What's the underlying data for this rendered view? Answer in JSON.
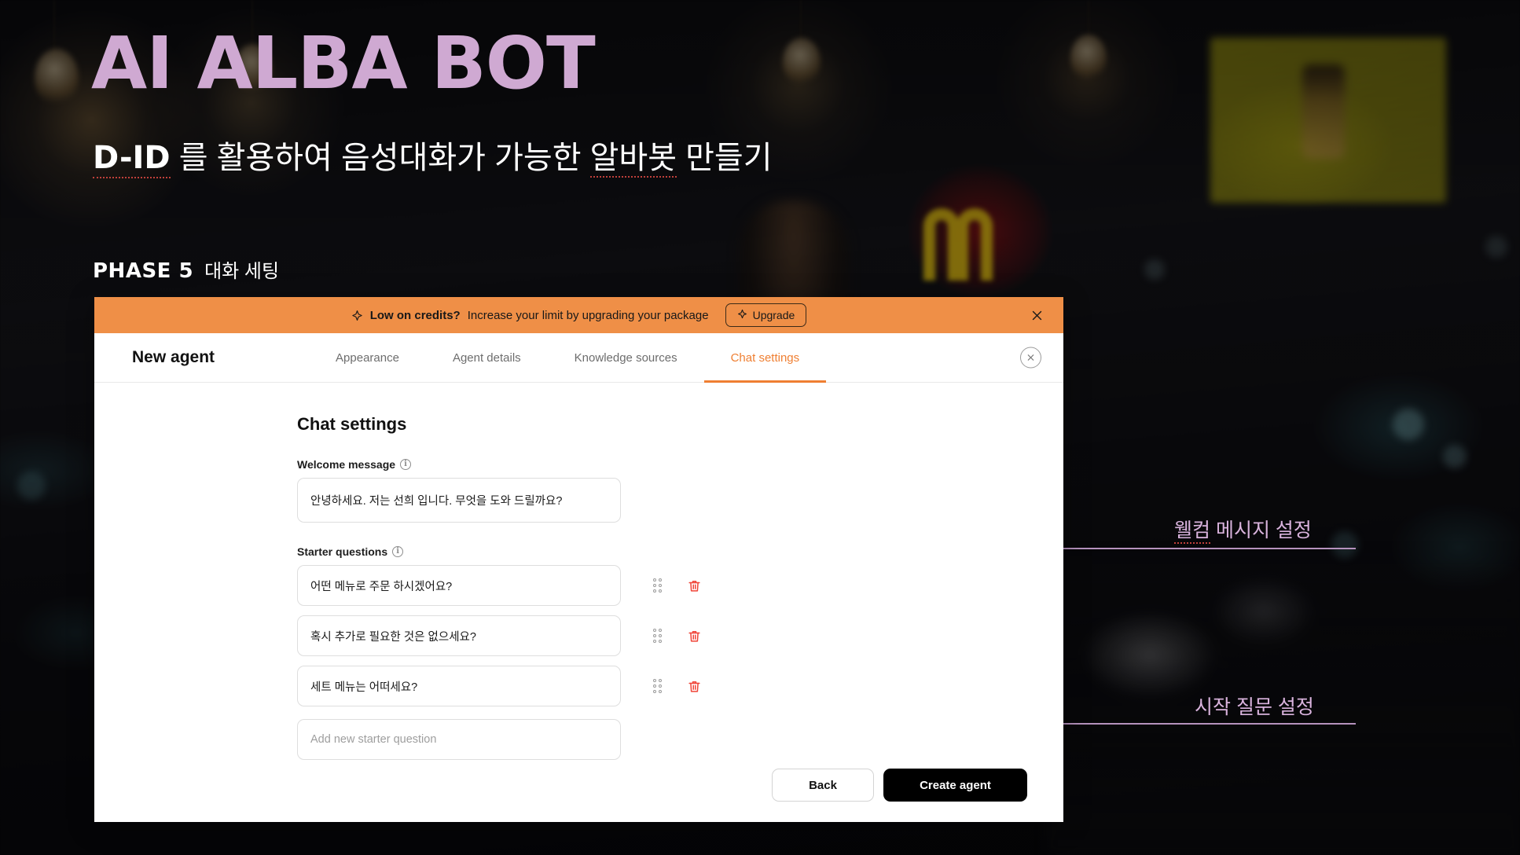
{
  "slide": {
    "title": "AI ALBA BOT",
    "subtitle_brand": "D-ID",
    "subtitle_rest_1": " 를 활용하여 음성대화가 가능한 ",
    "subtitle_highlight": "알바봇",
    "subtitle_rest_2": " 만들기",
    "phase_label": "PHASE 5",
    "phase_name": "대화 세팅",
    "accent_purple": "#cfa9d2",
    "annotation_color": "#d9b3dd"
  },
  "annotations": [
    {
      "text_prefix": "웰컴",
      "text_rest": " 메시지 설정"
    },
    {
      "text_prefix": "",
      "text_rest": "시작 질문 설정"
    }
  ],
  "banner": {
    "icon": "sparkle-icon",
    "strong_text": "Low on credits?",
    "text": "Increase your limit by upgrading your package",
    "upgrade_label": "Upgrade",
    "close_icon": "close-icon",
    "background_color": "#ef8f47"
  },
  "modal": {
    "agent_name": "New agent",
    "close_icon": "close-circle-icon",
    "tabs": [
      {
        "label": "Appearance",
        "active": false
      },
      {
        "label": "Agent details",
        "active": false
      },
      {
        "label": "Knowledge sources",
        "active": false
      },
      {
        "label": "Chat settings",
        "active": true
      }
    ],
    "active_tab_color": "#ef7f32"
  },
  "chat_settings": {
    "heading": "Chat settings",
    "welcome": {
      "label": "Welcome message",
      "info_icon": "info-icon",
      "value": "안녕하세요. 저는 선희 입니다. 무엇을 도와 드릴까요?"
    },
    "starter": {
      "label": "Starter questions",
      "info_icon": "info-icon",
      "items": [
        {
          "value": "어떤 메뉴로 주문 하시겠어요?",
          "drag_icon": "drag-handle-icon",
          "delete_icon": "trash-icon"
        },
        {
          "value": "혹시 추가로 필요한 것은 없으세요?",
          "drag_icon": "drag-handle-icon",
          "delete_icon": "trash-icon"
        },
        {
          "value": "세트 메뉴는 어떠세요?",
          "drag_icon": "drag-handle-icon",
          "delete_icon": "trash-icon"
        }
      ],
      "add_placeholder": "Add new starter question"
    }
  },
  "footer": {
    "back_label": "Back",
    "create_label": "Create agent"
  }
}
